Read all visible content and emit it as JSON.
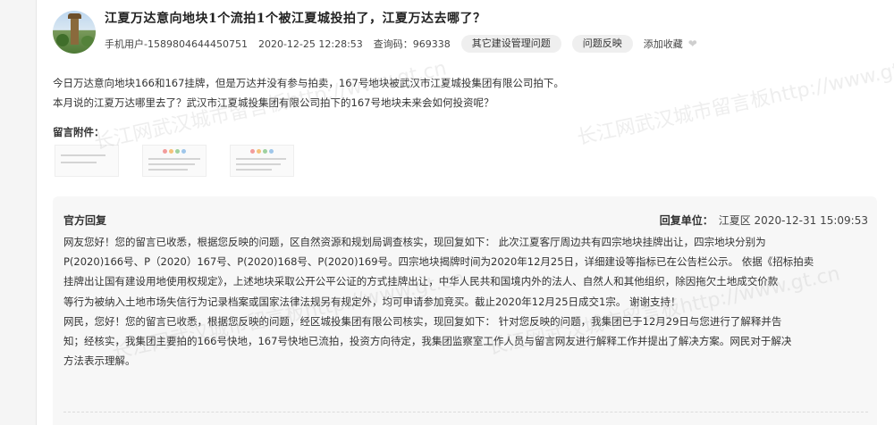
{
  "post": {
    "title": "江夏万达意向地块1个流拍1个被江夏城投拍了，江夏万达去哪了？",
    "user": "手机用户-1589804644450751",
    "datetime": "2020-12-25 12:28:53",
    "query_code_label": "查询码：",
    "query_code": "969338",
    "category_pill": "其它建设管理问题",
    "type_pill": "问题反映",
    "favorite_label": "添加收藏",
    "content_lines": [
      "今日万达意向地块166和167挂牌，但是万达并没有参与拍卖，167号地块被武汉市江夏城投集团有限公司拍下。",
      "本月说的江夏万达哪里去了？武汉市江夏城投集团有限公司拍下的167号地块未来会如何投资呢？"
    ],
    "attachments_label": "留言附件："
  },
  "reply": {
    "heading": "官方回复",
    "unit_label": "回复单位：",
    "unit": "江夏区",
    "datetime": "2020-12-31 15:09:53",
    "lines": [
      "网友您好！您的留言已收悉，根据您反映的问题，区自然资源和规划局调查核实，现回复如下：  此次江夏客厅周边共有四宗地块挂牌出让，四宗地块分别为",
      "P(2020)166号、P（2020）167号、P(2020)168号、P(2020)169号。四宗地块揭牌时间为2020年12月25日，详细建设等指标已在公告栏公示。 依据《招标拍卖",
      "挂牌出让国有建设用地使用权规定》，上述地块采取公开公平公证的方式挂牌出让，中华人民共和国境内外的法人、自然人和其他组织，除因拖欠土地成交价款",
      "等行为被纳入土地市场失信行为记录档案或国家法律法规另有规定外，均可申请参加竞买。截止2020年12月25日成交1宗。 谢谢支持！",
      "网民，您好！您的留言已收悉，根据您反映的问题，经区城投集团有限公司核实，现回复如下： 针对您反映的问题，我集团已于12月29日与您进行了解释并告",
      "知；经核实，我集团主要拍的166号快地，167号快地已流拍，投资方向待定，我集团监察室工作人员与留言网友进行解释工作并提出了解决方案。网民对于解决",
      "方法表示理解。"
    ]
  },
  "watermark": "长江网武汉城市留言板http://www.gt.cn"
}
